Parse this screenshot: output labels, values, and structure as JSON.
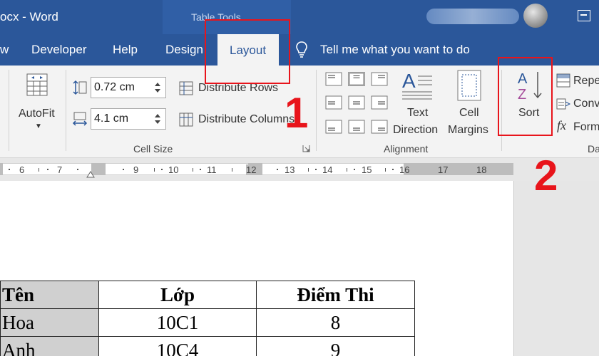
{
  "titlebar": {
    "title": "ocx  -  Word",
    "context_tab": "Table Tools"
  },
  "tabs": {
    "view_partial": "w",
    "developer": "Developer",
    "help": "Help",
    "design": "Design",
    "layout": "Layout",
    "tell_me": "Tell me what you want to do"
  },
  "ribbon": {
    "autofit": "AutoFit",
    "row_height": "0.72 cm",
    "col_width": "4.1 cm",
    "distribute_rows": "Distribute Rows",
    "distribute_columns": "Distribute Columns",
    "cell_size_group": "Cell Size",
    "text_direction_line1": "Text",
    "text_direction_line2": "Direction",
    "cell_margins_line1": "Cell",
    "cell_margins_line2": "Margins",
    "alignment_group": "Alignment",
    "sort": "Sort",
    "repeat_header": "Repe",
    "convert": "Conv",
    "formula": "Form",
    "data_group_partial": "Da"
  },
  "ruler": {
    "numbers": [
      "6",
      "7",
      "9",
      "10",
      "11",
      "12",
      "13",
      "14",
      "15",
      "16",
      "17",
      "18"
    ]
  },
  "table": {
    "headers": [
      "Tên",
      "Lớp",
      "Điểm Thi"
    ],
    "rows": [
      [
        "Hoa",
        "10C1",
        "8"
      ],
      [
        "Anh",
        "10C4",
        "9"
      ]
    ]
  },
  "annotations": {
    "step1": "1",
    "step2": "2",
    "color": "#e8141b"
  },
  "colors": {
    "word_blue": "#2b579a",
    "ribbon_bg": "#f3f3f3"
  }
}
